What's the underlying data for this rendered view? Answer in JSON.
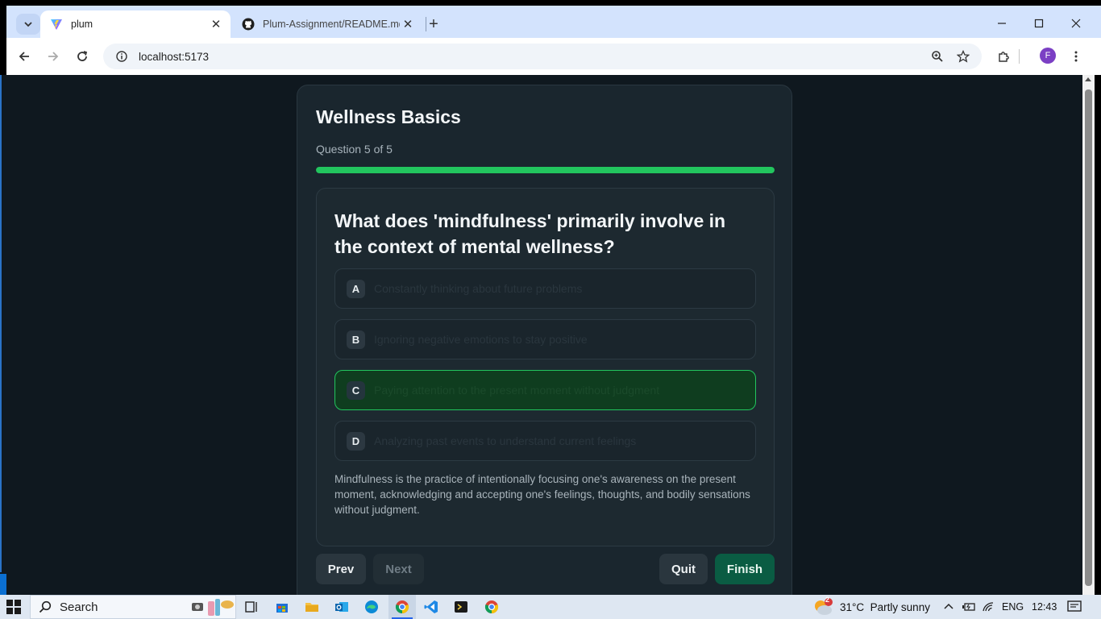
{
  "browser": {
    "tabs": [
      {
        "title": "plum",
        "active": true,
        "icon": "vite-icon"
      },
      {
        "title": "Plum-Assignment/README.md",
        "active": false,
        "icon": "github-icon"
      }
    ],
    "url": "localhost:5173",
    "profile_initial": "F"
  },
  "quiz": {
    "title": "Wellness Basics",
    "progress_text": "Question 5 of 5",
    "progress_percent": 100,
    "question": "What does 'mindfulness' primarily involve in the context of mental wellness?",
    "options": [
      {
        "letter": "A",
        "text": "Constantly thinking about future problems",
        "selected": false
      },
      {
        "letter": "B",
        "text": "Ignoring negative emotions to stay positive",
        "selected": false
      },
      {
        "letter": "C",
        "text": "Paying attention to the present moment without judgment",
        "selected": true
      },
      {
        "letter": "D",
        "text": "Analyzing past events to understand current feelings",
        "selected": false
      }
    ],
    "explanation": "Mindfulness is the practice of intentionally focusing one's awareness on the present moment, acknowledging and accepting one's feelings, thoughts, and bodily sensations without judgment.",
    "buttons": {
      "prev": "Prev",
      "next": "Next",
      "quit": "Quit",
      "finish": "Finish"
    }
  },
  "taskbar": {
    "search_label": "Search",
    "weather": "31°C  Partly sunny",
    "weather_badge": "2",
    "language": "ENG",
    "time": "12:43"
  },
  "colors": {
    "accent_green": "#22c55e",
    "finish_button": "#0a5c43",
    "page_bg": "#0f181f",
    "card_bg": "#1a262e"
  }
}
